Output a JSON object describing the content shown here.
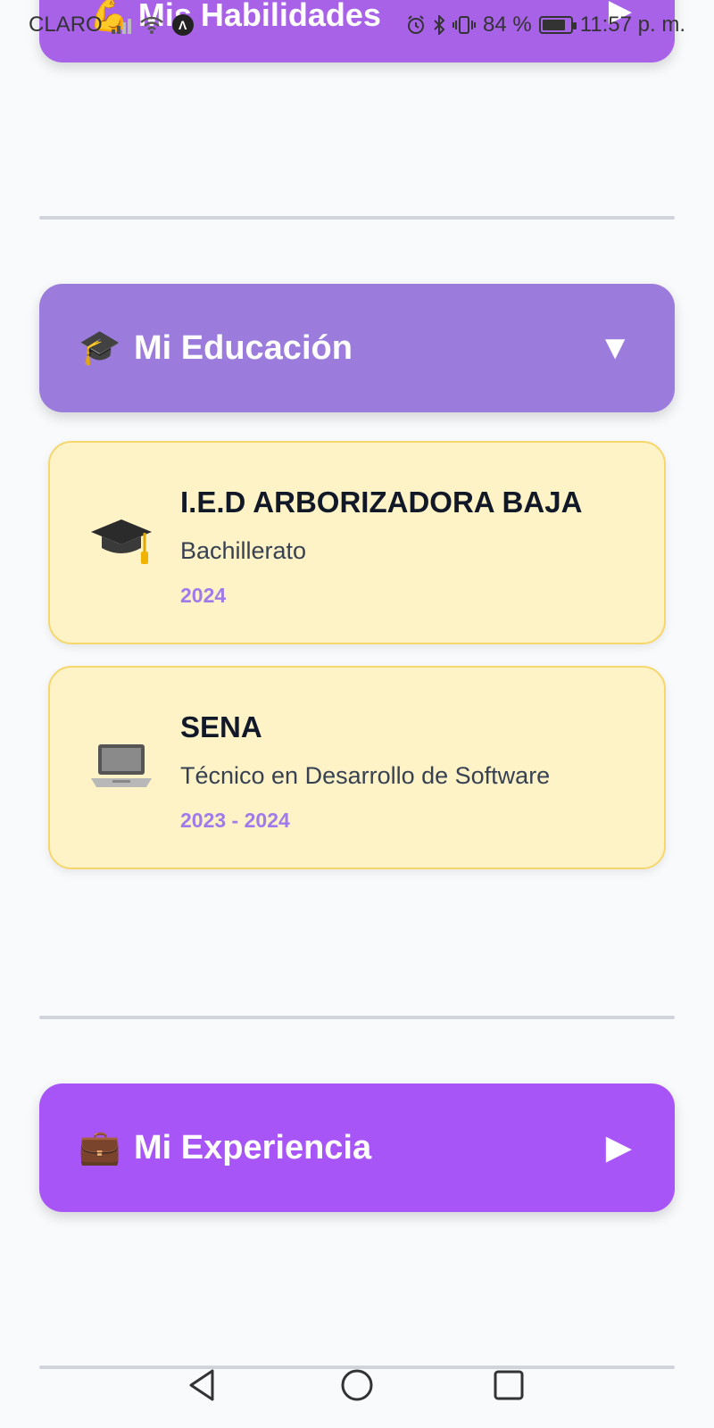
{
  "status_bar": {
    "carrier": "CLARO",
    "battery": "84 %",
    "time": "11:57 p. m."
  },
  "sections": {
    "skills": {
      "emoji": "💪",
      "label": "Mis Habilidades",
      "arrow": "▶",
      "color": "#a862e8"
    },
    "education": {
      "emoji": "🎓",
      "label": "Mi Educación",
      "arrow": "▼",
      "color": "#9b7bdc"
    },
    "experience": {
      "emoji": "💼",
      "label": "Mi Experiencia",
      "arrow": "▶",
      "color": "#a855f7"
    }
  },
  "education_items": [
    {
      "icon": "graduation-cap-icon",
      "title": "I.E.D ARBORIZADORA BAJA",
      "subtitle": "Bachillerato",
      "years": "2024"
    },
    {
      "icon": "laptop-icon",
      "title": "SENA",
      "subtitle": "Técnico en Desarrollo de Software",
      "years": "2023 - 2024"
    }
  ],
  "navigation": {
    "back": "back-icon",
    "home": "home-icon",
    "recents": "recents-icon"
  },
  "colors": {
    "card_bg": "#fef3c7",
    "card_border": "#f5d76e",
    "year_text": "#9f7aea",
    "page_bg": "#f8fafc"
  }
}
